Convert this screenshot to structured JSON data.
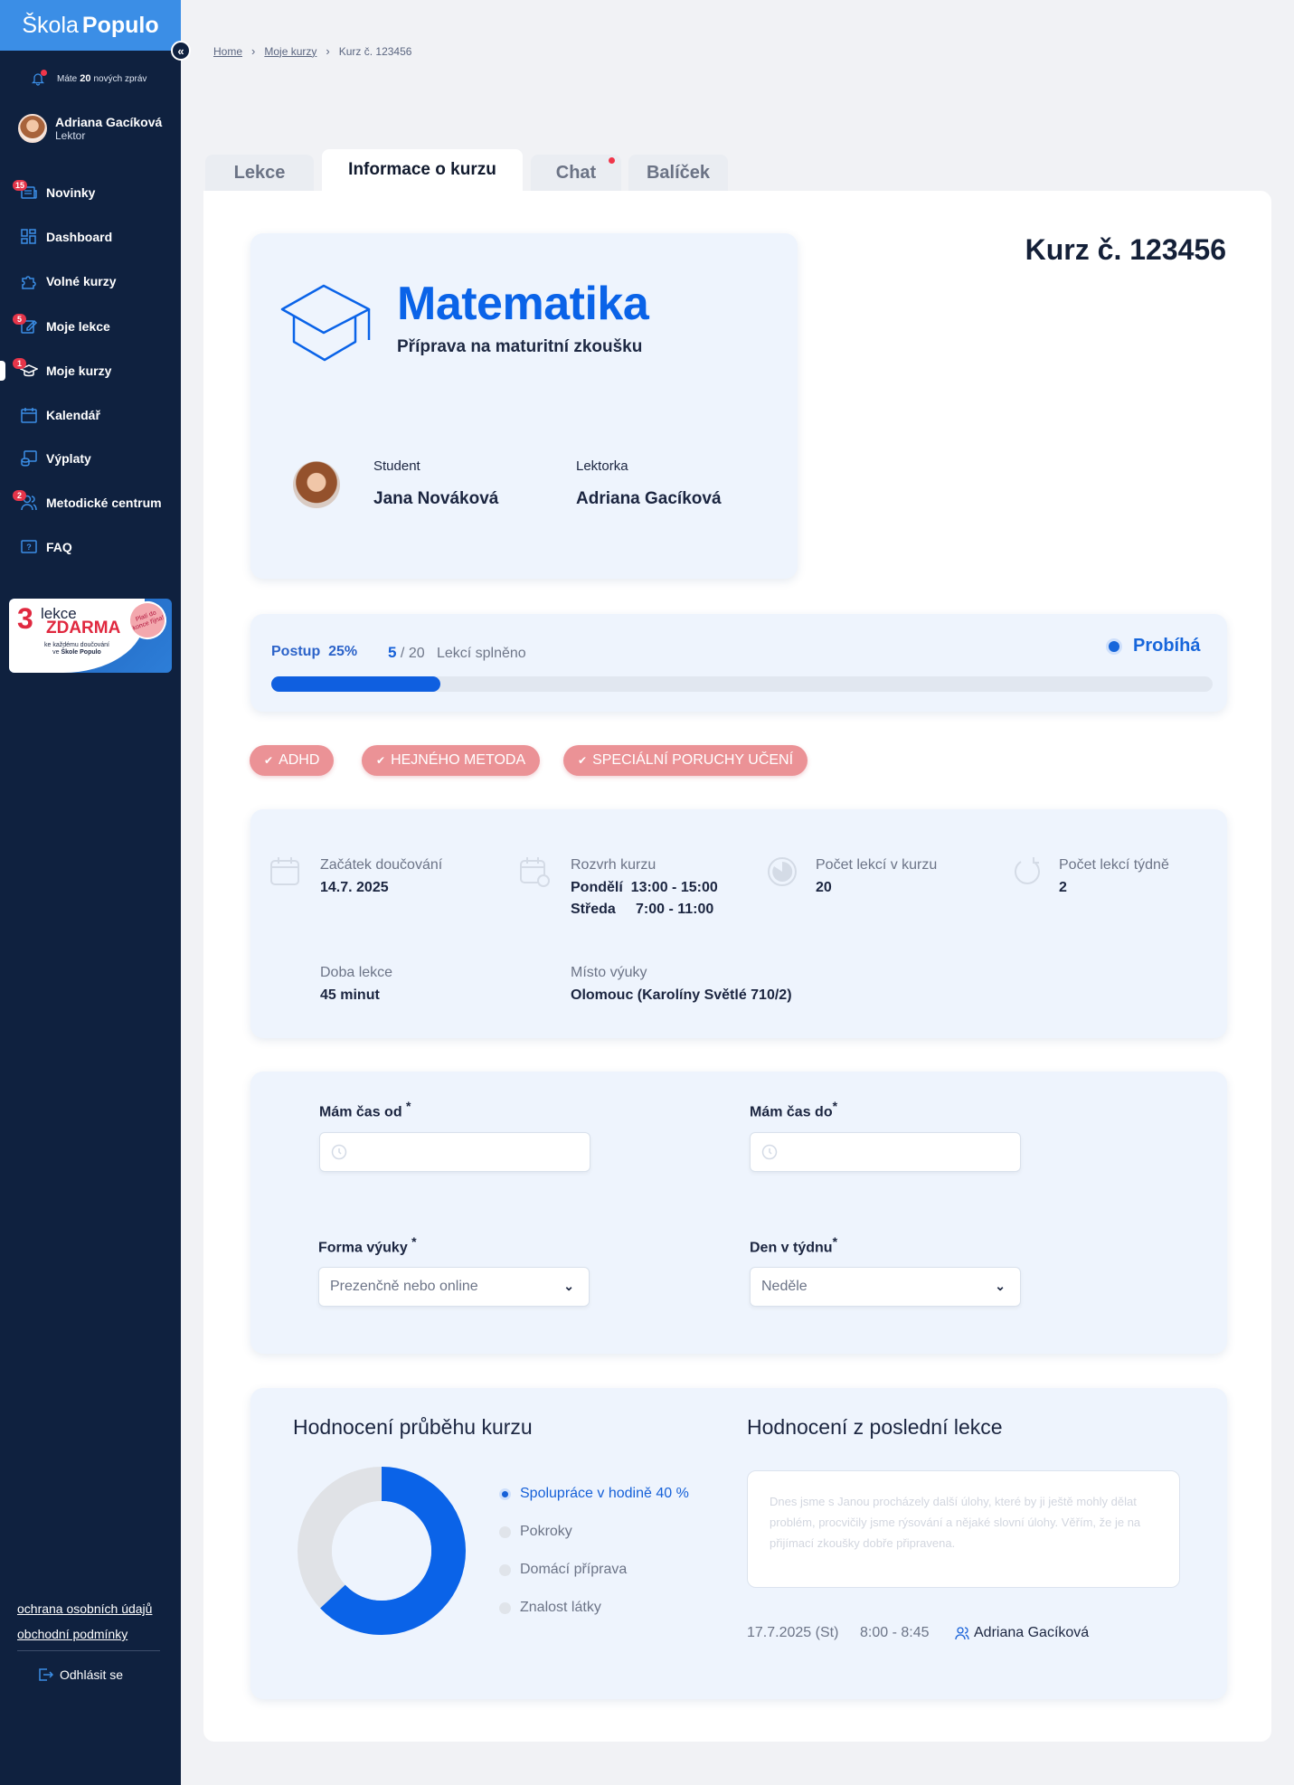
{
  "sidebar": {
    "logo_a": "Škola",
    "logo_b": "Populo",
    "notif_prefix": "Máte",
    "notif_count": "20",
    "notif_suffix": "nových zpráv",
    "user_name": "Adriana Gacíková",
    "user_role": "Lektor",
    "items": [
      {
        "label": "Novinky",
        "badge": "15",
        "icon": "news-icon"
      },
      {
        "label": "Dashboard",
        "badge": "",
        "icon": "dashboard-icon"
      },
      {
        "label": "Volné kurzy",
        "badge": "",
        "icon": "puzzle-icon"
      },
      {
        "label": "Moje lekce",
        "badge": "5",
        "icon": "edit-icon"
      },
      {
        "label": "Moje kurzy",
        "badge": "1",
        "icon": "graduation-cap-icon"
      },
      {
        "label": "Kalendář",
        "badge": "",
        "icon": "calendar-icon"
      },
      {
        "label": "Výplaty",
        "badge": "",
        "icon": "coins-icon"
      },
      {
        "label": "Metodické centrum",
        "badge": "2",
        "icon": "users-icon"
      },
      {
        "label": "FAQ",
        "badge": "",
        "icon": "question-icon"
      }
    ],
    "promo": {
      "num": "3",
      "line1": "lekce",
      "line2": "ZDARMA",
      "small_a": "ke každému doučování",
      "small_b": "ve",
      "brand": "Škole Populo",
      "seal": "Platí do konce října!"
    },
    "privacy": "ochrana osobních údajů",
    "terms": "obchodní podmínky",
    "logout": "Odhlásit se"
  },
  "breadcrumb": {
    "home": "Home",
    "courses": "Moje kurzy",
    "current": "Kurz č. 123456"
  },
  "tabs": {
    "lekce": "Lekce",
    "info": "Informace o kurzu",
    "chat": "Chat",
    "balicek": "Balíček"
  },
  "course": {
    "number_title": "Kurz č. 123456",
    "subject": "Matematika",
    "subtitle": "Příprava na maturitní zkoušku",
    "student_label": "Student",
    "student_name": "Jana  Nováková",
    "tutor_label": "Lektorka",
    "tutor_name": "Adriana Gacíková"
  },
  "progress": {
    "label": "Postup",
    "percent": "25%",
    "percent_value": 25,
    "done": "5",
    "total": "/ 20",
    "suffix": "Lekcí splněno",
    "status": "Probíhá"
  },
  "tags": [
    "ADHD",
    "HEJNÉHO METODA",
    "SPECIÁLNÍ PORUCHY UČENÍ"
  ],
  "info": {
    "start_label": "Začátek doučování",
    "start_value": "14.7. 2025",
    "schedule_label": "Rozvrh kurzu",
    "schedule_1": "Pondělí  13:00 - 15:00",
    "schedule_2": "Středa     7:00 - 11:00",
    "count_label": "Počet lekcí v kurzu",
    "count_value": "20",
    "weekly_label": "Počet lekcí týdně",
    "weekly_value": "2",
    "duration_label": "Doba lekce",
    "duration_value": "45 minut",
    "place_label": "Místo výuky",
    "place_value": "Olomouc (Karolíny Světlé 710/2)"
  },
  "form": {
    "from_label": "Mám čas od",
    "to_label": "Mám čas do",
    "form_label": "Forma výuky",
    "form_value": "Prezenčně nebo online",
    "day_label": "Den v týdnu",
    "day_value": "Neděle",
    "required": "*"
  },
  "evaluation": {
    "title": "Hodnocení průběhu kurzu",
    "last_title": "Hodnocení z poslední lekce",
    "legend": [
      "Spolupráce v hodině",
      "Pokroky",
      "Domácí příprava",
      "Znalost látky"
    ],
    "active_value": "40 %",
    "donut_fraction": 0.63,
    "note": "Dnes jsme s Janou procházely další úlohy, které by ji ještě mohly dělat problém, procvičily jsme rýsování a nějaké slovní úlohy. Věřím, že je na přijímací zkoušky dobře připravena.",
    "date": "17.7.2025 (St)",
    "time": "8:00 - 8:45",
    "tutor": "Adriana Gacíková"
  },
  "colors": {
    "accent": "#0a63e8",
    "sidebar": "#0f213f",
    "tag": "#eb9296",
    "card": "#eef4fd"
  }
}
